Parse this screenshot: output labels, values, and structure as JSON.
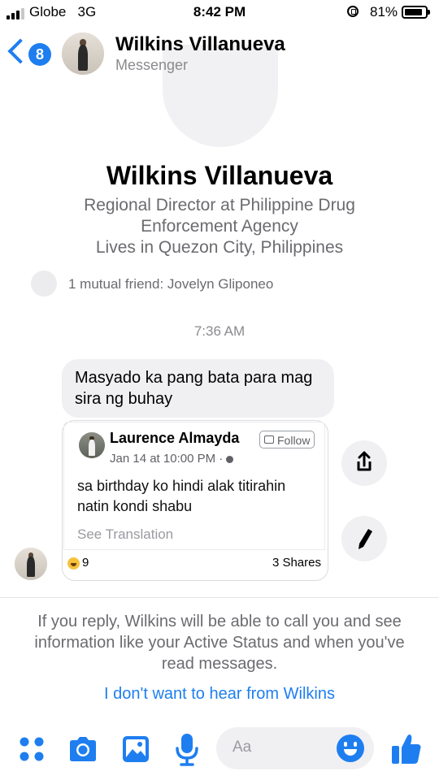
{
  "status_bar": {
    "carrier": "Globe",
    "network": "3G",
    "time": "8:42 PM",
    "battery": "81%",
    "battery_level": 0.81,
    "icons": [
      "signal-icon",
      "rotation-lock-icon",
      "battery-icon"
    ]
  },
  "header": {
    "back_badge": "8",
    "name": "Wilkins Villanueva",
    "subtitle": "Messenger"
  },
  "profile": {
    "name": "Wilkins Villanueva",
    "lines": [
      "Regional Director at Philippine Drug",
      "Enforcement Agency",
      "Lives in Quezon City, Philippines"
    ],
    "mutual": "1 mutual friend: Jovelyn Gliponeo"
  },
  "thread": {
    "timestamp": "7:36 AM",
    "message": "Masyado ka pang bata para mag sira ng buhay",
    "shared_post": {
      "author": "Laurence Almayda",
      "date": "Jan 14 at 10:00 PM · ",
      "follow_label": "Follow",
      "text": "sa birthday ko hindi alak titirahin natin kondi shabu",
      "see_translation": "See Translation",
      "reaction_count": "9",
      "shares": "3 Shares"
    }
  },
  "notice": {
    "text": "If you reply, Wilkins will be able to call you and see information like your Active Status and when you've read messages.",
    "ignore_link": "I don't want to hear from Wilkins"
  },
  "composer": {
    "placeholder": "Aa",
    "icons": [
      "apps-icon",
      "camera-icon",
      "gallery-icon",
      "microphone-icon",
      "emoji-icon",
      "like-icon"
    ]
  },
  "colors": {
    "accent": "#1e7ef0",
    "bubble": "#f0f0f2",
    "muted_text": "#6b6b70"
  }
}
